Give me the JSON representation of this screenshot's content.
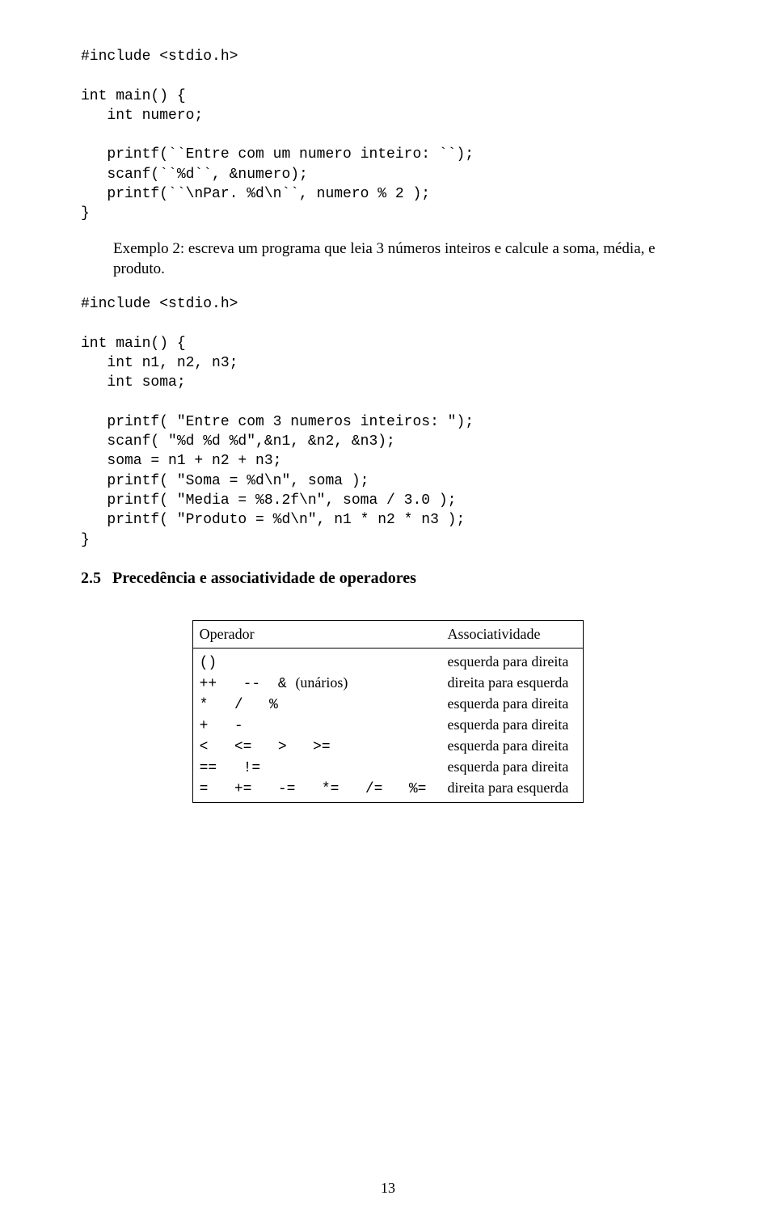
{
  "code1": "#include <stdio.h>\n\nint main() {\n   int numero;\n\n   printf(``Entre com um numero inteiro: ``);\n   scanf(``%d``, &numero);\n   printf(``\\nPar. %d\\n``, numero % 2 );\n}",
  "example2_text": "Exemplo 2: escreva um programa que leia 3 números inteiros e calcule a soma, média, e produto.",
  "code2": "#include <stdio.h>\n\nint main() {\n   int n1, n2, n3;\n   int soma;\n\n   printf( \"Entre com 3 numeros inteiros: \");\n   scanf( \"%d %d %d\",&n1, &n2, &n3);\n   soma = n1 + n2 + n3;\n   printf( \"Soma = %d\\n\", soma );\n   printf( \"Media = %8.2f\\n\", soma / 3.0 );\n   printf( \"Produto = %d\\n\", n1 * n2 * n3 );\n}",
  "section": {
    "number": "2.5",
    "title": "Precedência e associatividade de operadores"
  },
  "table": {
    "header_op": "Operador",
    "header_assoc": "Associatividade",
    "rows": [
      {
        "op": "()",
        "unary_suffix": "",
        "assoc": "esquerda para direita"
      },
      {
        "op": "++   --  & ",
        "unary_suffix": "(unários)",
        "assoc": "direita para esquerda"
      },
      {
        "op": "*   /   %",
        "unary_suffix": "",
        "assoc": "esquerda para direita"
      },
      {
        "op": "+   -",
        "unary_suffix": "",
        "assoc": "esquerda para direita"
      },
      {
        "op": "<   <=   >   >=",
        "unary_suffix": "",
        "assoc": "esquerda para direita"
      },
      {
        "op": "==   !=",
        "unary_suffix": "",
        "assoc": "esquerda para direita"
      },
      {
        "op": "=   +=   -=   *=   /=   %=",
        "unary_suffix": "",
        "assoc": "direita para esquerda"
      }
    ]
  },
  "page_number": "13"
}
